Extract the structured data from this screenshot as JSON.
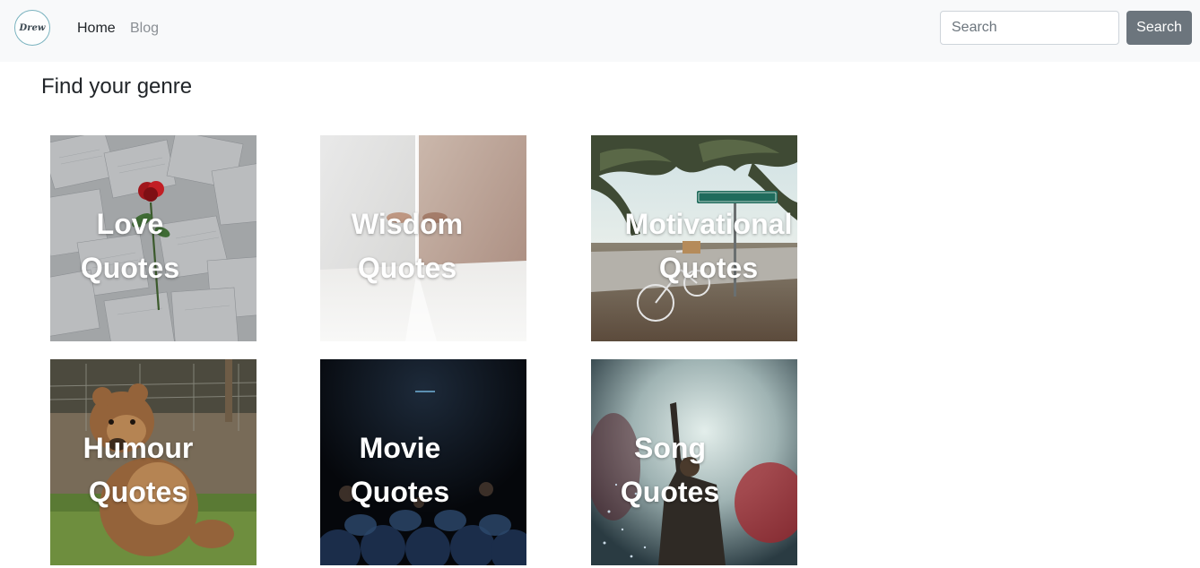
{
  "navbar": {
    "logo_text": "Drew",
    "links": [
      {
        "label": "Home"
      },
      {
        "label": "Blog"
      }
    ],
    "search": {
      "placeholder": "Search",
      "button_label": "Search"
    }
  },
  "main": {
    "title": "Find your genre",
    "cards": [
      {
        "line1": "Love",
        "line2": "Quotes"
      },
      {
        "line1": "Wisdom",
        "line2": "Quotes"
      },
      {
        "line1": "Motivational",
        "line2": "Quotes"
      },
      {
        "line1": "Humour",
        "line2": "Quotes"
      },
      {
        "line1": "Movie",
        "line2": "Quotes"
      },
      {
        "line1": "Song",
        "line2": "Quotes"
      }
    ]
  },
  "colors": {
    "navbar_bg": "#f8f9fa",
    "search_button": "#6c757d",
    "text_dark": "#212529",
    "text_muted": "#8a8f94"
  }
}
